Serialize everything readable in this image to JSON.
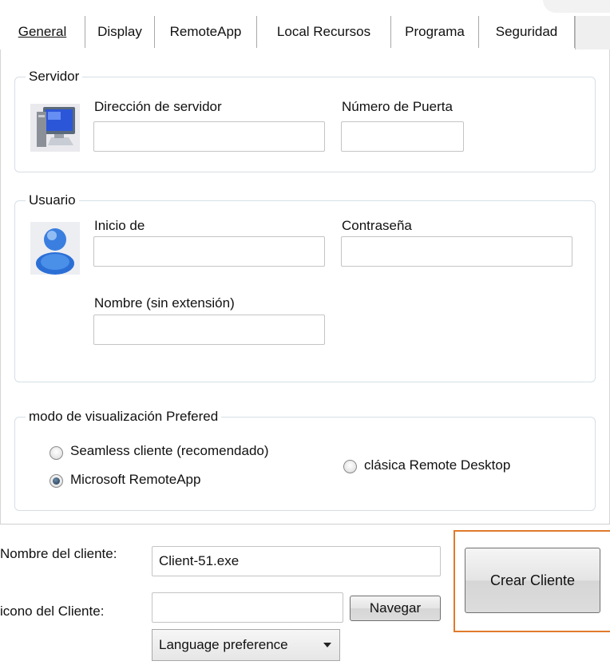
{
  "tabs": [
    {
      "label": "General",
      "active": true
    },
    {
      "label": "Display"
    },
    {
      "label": "RemoteApp"
    },
    {
      "label": "Local Recursos"
    },
    {
      "label": "Programa"
    },
    {
      "label": "Seguridad"
    }
  ],
  "servidor": {
    "title": "Servidor",
    "icon": "computer-monitor-icon",
    "server_address_label": "Dirección de servidor",
    "server_address_value": "",
    "port_label": "Número de Puerta",
    "port_value": ""
  },
  "usuario": {
    "title": "Usuario",
    "icon": "user-icon",
    "login_label": "Inicio de",
    "login_value": "",
    "password_label": "Contraseña",
    "password_value": "",
    "name_label": "Nombre (sin extensión)",
    "name_value": ""
  },
  "display_mode": {
    "title": "modo de visualización Prefered",
    "options": [
      {
        "label": "Seamless cliente (recomendado)",
        "checked": false
      },
      {
        "label": "Microsoft RemoteApp",
        "checked": true
      },
      {
        "label": "clásica Remote Desktop",
        "checked": false
      }
    ]
  },
  "client": {
    "name_label": "Nombre del cliente:",
    "name_value": "Client-51.exe",
    "icon_label": "icono del Cliente:",
    "icon_value": "",
    "browse_button": "Navegar",
    "language_select": "Language preference",
    "create_button": "Crear Cliente"
  },
  "colors": {
    "highlight": "#e07a2b",
    "group_border": "#d5dfe5"
  }
}
